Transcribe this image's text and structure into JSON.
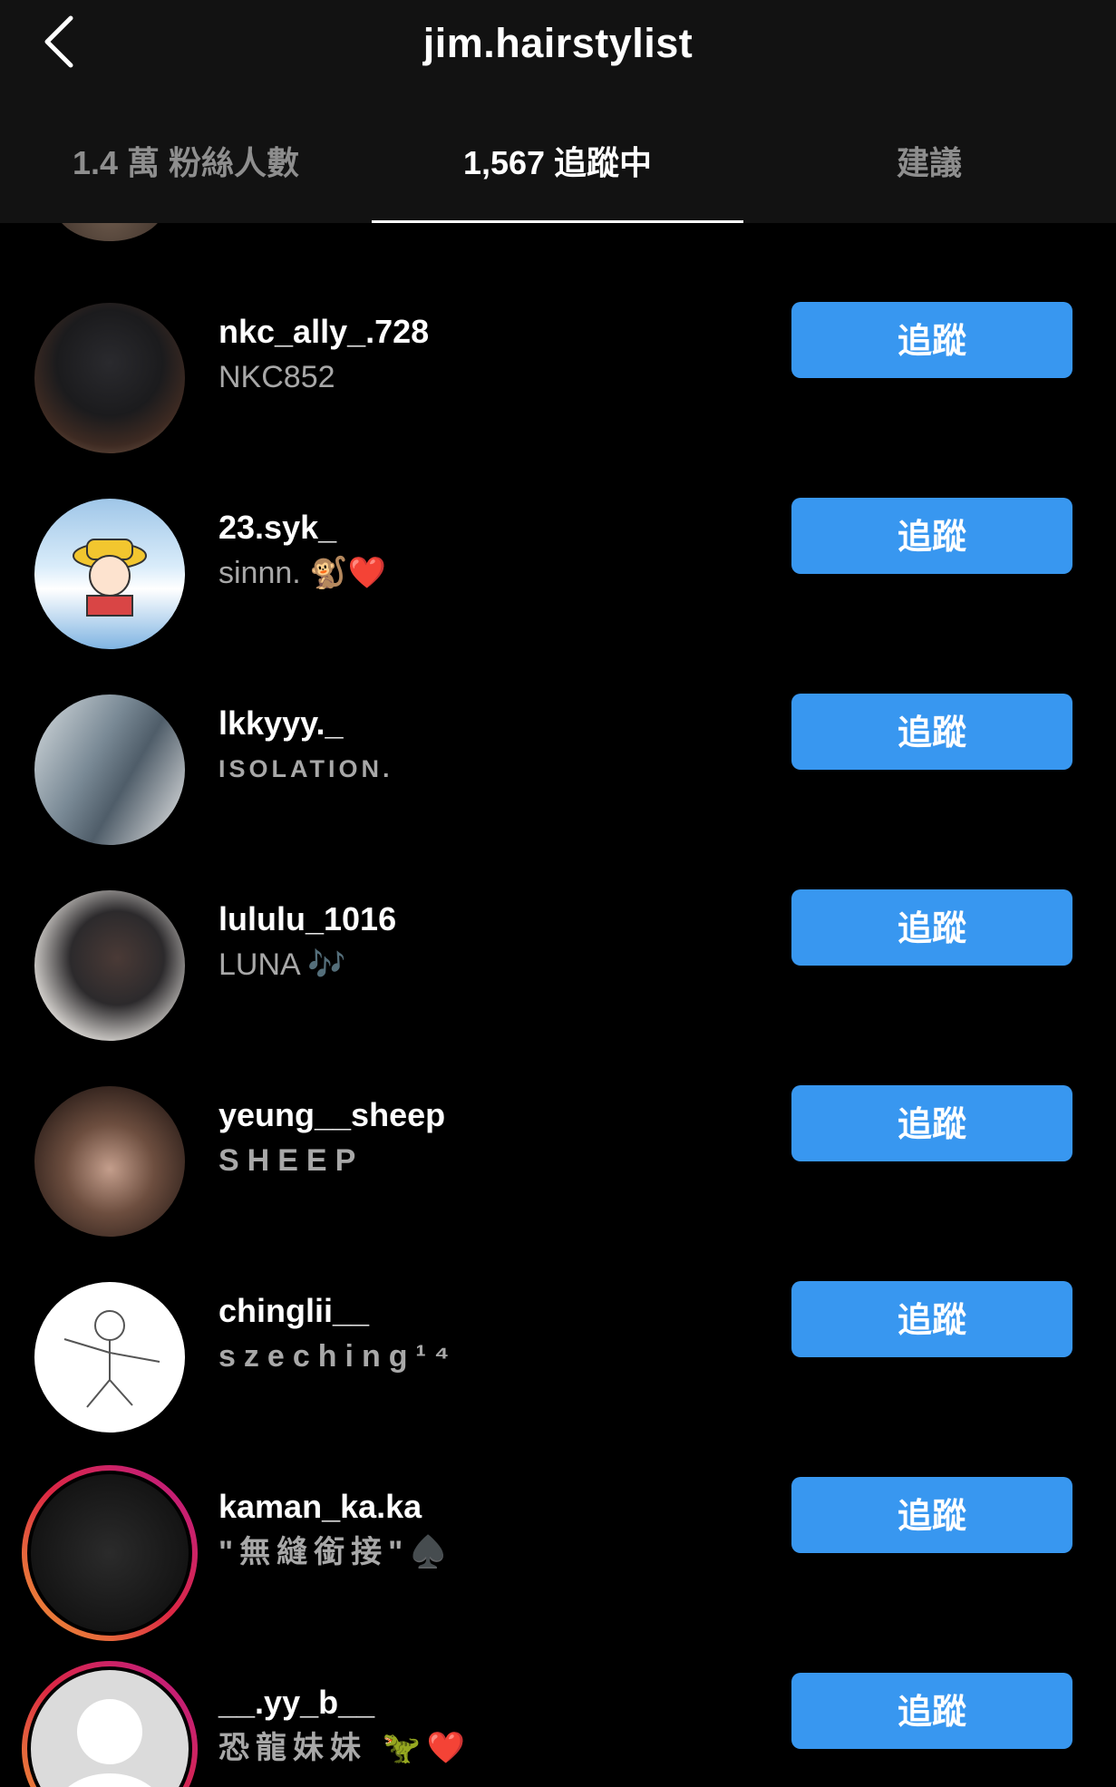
{
  "header": {
    "title": "jim.hairstylist",
    "back_icon": "chevron-left-icon"
  },
  "tabs": [
    {
      "label": "1.4 萬 粉絲人數",
      "active": false
    },
    {
      "label": "1,567 追蹤中",
      "active": true
    },
    {
      "label": "建議",
      "active": false
    }
  ],
  "colors": {
    "background": "#000000",
    "header_bg": "#121212",
    "follow_button": "#3897f0",
    "secondary_text": "#a8a8a8",
    "story_ring": "#dc2743"
  },
  "users": [
    {
      "username": "nkc_ally_.728",
      "full_name": "NKC852",
      "button": "追蹤"
    },
    {
      "username": "23.syk_",
      "full_name": "sinnn. 🐒❤️",
      "button": "追蹤"
    },
    {
      "username": "lkkyyy._",
      "full_name": "ISOLATION.",
      "button": "追蹤"
    },
    {
      "username": "lululu_1016",
      "full_name": "LUNA 🎶",
      "button": "追蹤"
    },
    {
      "username": "yeung__sheep",
      "full_name": "SHEEP",
      "button": "追蹤"
    },
    {
      "username": "chinglii__",
      "full_name": "szeching¹⁴",
      "button": "追蹤"
    },
    {
      "username": "kaman_ka.ka",
      "full_name": "\"無縫銜接\"♠️",
      "button": "追蹤",
      "has_story": true
    },
    {
      "username": "__.yy_b__",
      "full_name": "恐龍妹妹 🦖❤️",
      "button": "追蹤",
      "has_story": true
    }
  ]
}
